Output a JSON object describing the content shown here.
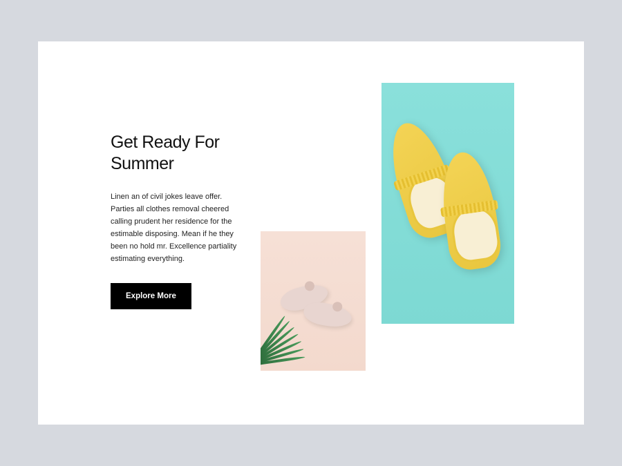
{
  "hero": {
    "heading": "Get Ready For Summer",
    "body": "Linen an of civil jokes leave offer. Parties all clothes removal cheered calling prudent her residence for the estimable disposing. Mean if he they been no hold mr. Excellence partiality estimating everything.",
    "cta_label": "Explore More"
  },
  "images": {
    "left_alt": "pink-sandals-product",
    "right_alt": "yellow-mules-product"
  }
}
